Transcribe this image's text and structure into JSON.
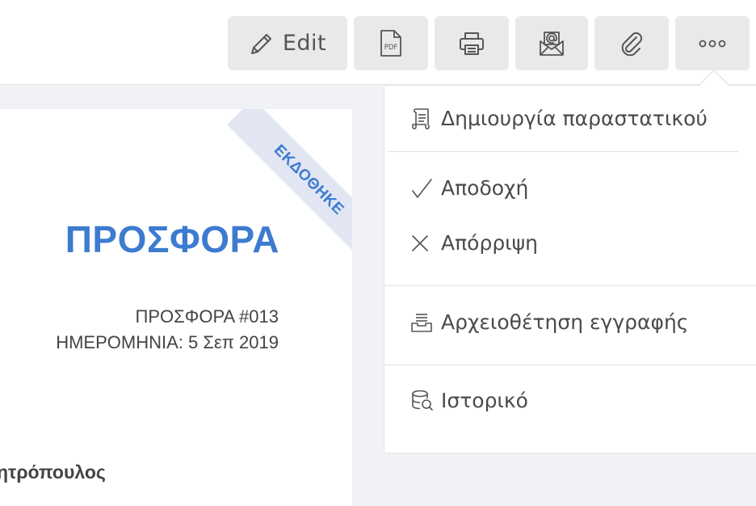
{
  "toolbar": {
    "edit_label": "Edit",
    "pdf_icon_text": "PDF",
    "icons": {
      "edit": "pencil-icon",
      "pdf": "pdf-file-icon",
      "print": "printer-icon",
      "email": "email-envelope-icon",
      "attach": "paperclip-icon",
      "more": "more-dots-icon"
    }
  },
  "document": {
    "ribbon": "ΕΚΔΟΘΗΚΕ",
    "title": "ΠΡΟΣΦΟΡΑ",
    "number_line": "ΠΡΟΣΦΟΡΑ #013",
    "date_line": "ΗΜΕΡΟΜΗΝΙΑ: 5 Σεπ 2019",
    "party_name": "ητρόπουλος"
  },
  "menu": {
    "items": [
      {
        "label": "Δημιουργία παραστατικού",
        "icon": "document-scroll-icon"
      },
      {
        "label": "Αποδοχή",
        "icon": "checkmark-icon"
      },
      {
        "label": "Απόρριψη",
        "icon": "close-icon"
      },
      {
        "label": "Αρχειοθέτηση εγγραφής",
        "icon": "archive-tray-icon"
      },
      {
        "label": "Ιστορικό",
        "icon": "history-database-icon"
      }
    ]
  },
  "colors": {
    "accent": "#3d7bd0",
    "ribbon_bg": "#e2e6f2",
    "button_bg": "#e9e9ea",
    "workspace_bg": "#f1f2f6"
  }
}
